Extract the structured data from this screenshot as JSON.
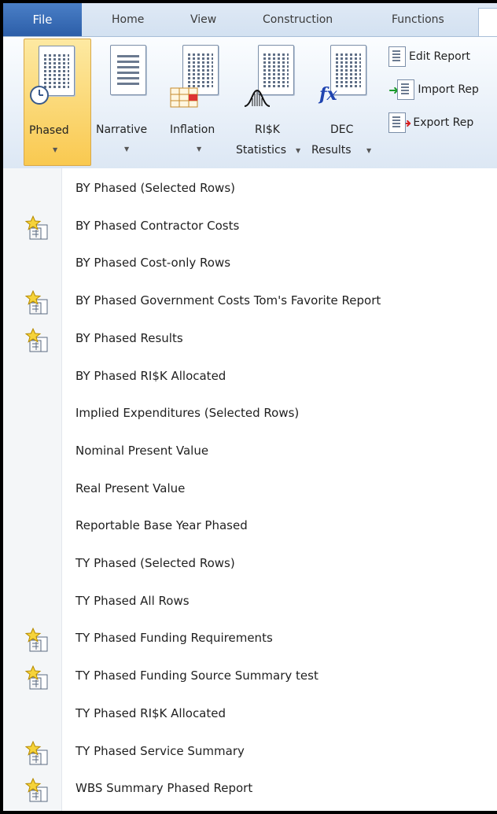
{
  "tabs": {
    "file": "File",
    "items": [
      "Home",
      "View",
      "Construction",
      "Functions"
    ]
  },
  "ribbon": {
    "phased": {
      "label": "Phased"
    },
    "narrative": {
      "label": "Narrative"
    },
    "inflation": {
      "label": "Inflation"
    },
    "risk": {
      "line1": "RI$K",
      "line2": "Statistics"
    },
    "dec": {
      "line1": "DEC",
      "line2": "Results"
    },
    "small_buttons": {
      "edit": "Edit Report",
      "import": "Import Rep",
      "export": "Export Rep"
    }
  },
  "menu": {
    "items": [
      {
        "label": "BY Phased (Selected Rows)",
        "favorite": false
      },
      {
        "label": "BY Phased Contractor Costs",
        "favorite": true
      },
      {
        "label": "BY Phased Cost-only Rows",
        "favorite": false
      },
      {
        "label": "BY Phased Government Costs Tom's Favorite Report",
        "favorite": true
      },
      {
        "label": "BY Phased Results",
        "favorite": true
      },
      {
        "label": "BY Phased RI$K Allocated",
        "favorite": false
      },
      {
        "label": "Implied Expenditures (Selected Rows)",
        "favorite": false
      },
      {
        "label": "Nominal Present Value",
        "favorite": false
      },
      {
        "label": "Real Present Value",
        "favorite": false
      },
      {
        "label": "Reportable Base Year Phased",
        "favorite": false
      },
      {
        "label": "TY Phased (Selected Rows)",
        "favorite": false
      },
      {
        "label": "TY Phased All Rows",
        "favorite": false
      },
      {
        "label": "TY Phased Funding Requirements",
        "favorite": true
      },
      {
        "label": "TY Phased Funding Source Summary test",
        "favorite": true
      },
      {
        "label": "TY Phased RI$K Allocated",
        "favorite": false
      },
      {
        "label": "TY Phased Service Summary",
        "favorite": true
      },
      {
        "label": "WBS Summary Phased Report",
        "favorite": true
      }
    ]
  }
}
